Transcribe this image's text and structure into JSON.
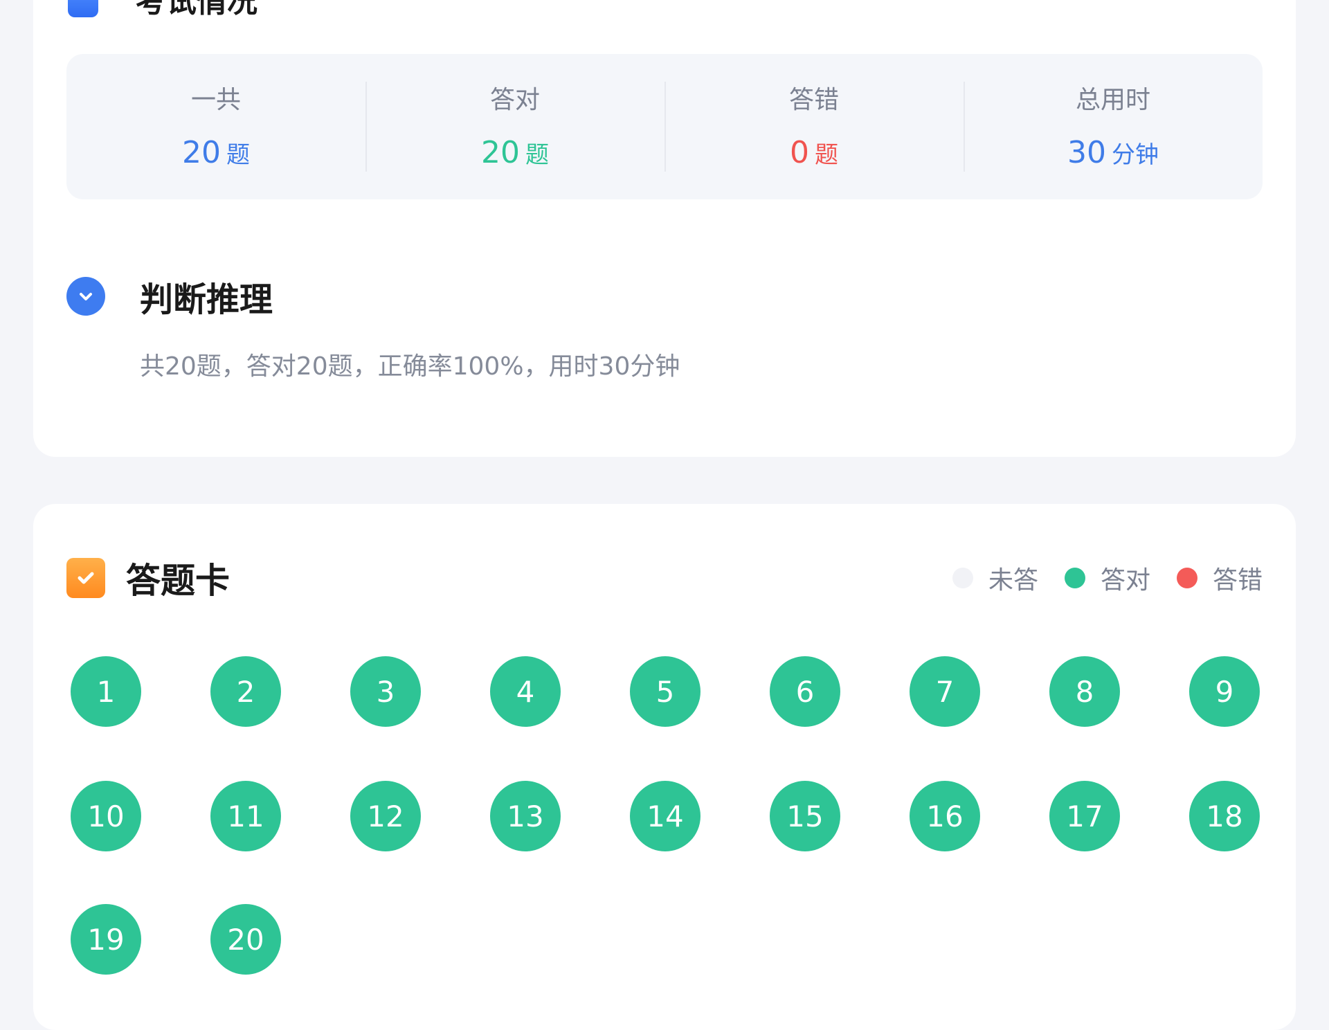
{
  "summary": {
    "title": "考试情况",
    "stats": [
      {
        "label": "一共",
        "value": "20",
        "unit": "题",
        "color": "#3f7ce8"
      },
      {
        "label": "答对",
        "value": "20",
        "unit": "题",
        "color": "#2ec495"
      },
      {
        "label": "答错",
        "value": "0",
        "unit": "题",
        "color": "#f0534f"
      },
      {
        "label": "总用时",
        "value": "30",
        "unit": "分钟",
        "color": "#3f7ce8"
      }
    ]
  },
  "section": {
    "title": "判断推理",
    "description": "共20题，答对20题，正确率100%，用时30分钟"
  },
  "answer_card": {
    "title": "答题卡",
    "legend": [
      {
        "label": "未答",
        "color": "#f1f2f6"
      },
      {
        "label": "答对",
        "color": "#2ec495"
      },
      {
        "label": "答错",
        "color": "#f45b58"
      }
    ],
    "questions": [
      "1",
      "2",
      "3",
      "4",
      "5",
      "6",
      "7",
      "8",
      "9",
      "10",
      "11",
      "12",
      "13",
      "14",
      "15",
      "16",
      "17",
      "18",
      "19",
      "20"
    ],
    "correct_color": "#2ec495"
  }
}
